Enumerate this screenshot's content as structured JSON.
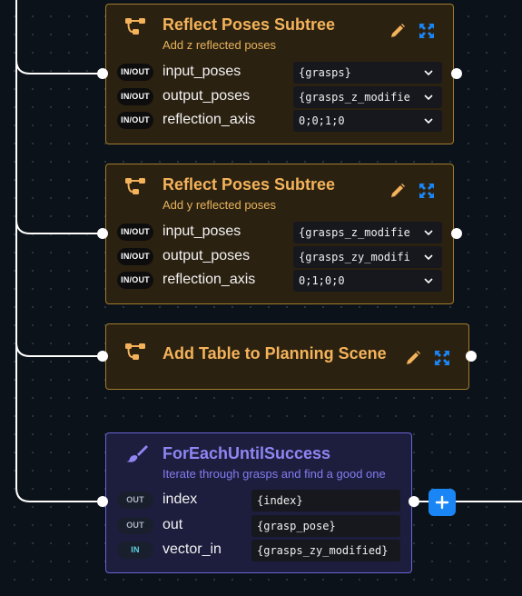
{
  "nodes": [
    {
      "title": "Reflect Poses Subtree",
      "subtitle": "Add z reflected poses",
      "ports": [
        {
          "badge": "IN/OUT",
          "name": "input_poses",
          "value": "{grasps}"
        },
        {
          "badge": "IN/OUT",
          "name": "output_poses",
          "value": "{grasps_z_modifie"
        },
        {
          "badge": "IN/OUT",
          "name": "reflection_axis",
          "value": "0;0;1;0"
        }
      ]
    },
    {
      "title": "Reflect Poses Subtree",
      "subtitle": "Add y reflected poses",
      "ports": [
        {
          "badge": "IN/OUT",
          "name": "input_poses",
          "value": "{grasps_z_modifie"
        },
        {
          "badge": "IN/OUT",
          "name": "output_poses",
          "value": "{grasps_zy_modifi"
        },
        {
          "badge": "IN/OUT",
          "name": "reflection_axis",
          "value": "0;1;0;0"
        }
      ]
    },
    {
      "title": "Add Table to Planning Scene"
    },
    {
      "title": "ForEachUntilSuccess",
      "subtitle": "Iterate through grasps and find a good one",
      "ports": [
        {
          "badge": "OUT",
          "name": "index",
          "value": "{index}"
        },
        {
          "badge": "OUT",
          "name": "out",
          "value": "{grasp_pose}"
        },
        {
          "badge": "IN",
          "name": "vector_in",
          "value": "{grasps_zy_modified}"
        }
      ]
    }
  ],
  "add_button_label": "+",
  "colors": {
    "canvas": "#0b1219",
    "subtree_fill": "#2b2111",
    "subtree_border": "#a27b2c",
    "subtree_title": "#f4b35a",
    "loop_fill": "#1d1d3d",
    "loop_border": "#6b64d6",
    "loop_title": "#8f86f3",
    "icon_blue": "#1a86f5"
  },
  "icons": {
    "subtree": "subtree-icon",
    "edit": "pencil-icon",
    "expand": "expand-icon",
    "decorator": "brush-icon",
    "dropdown": "chevron-down-icon",
    "add": "plus-icon"
  }
}
